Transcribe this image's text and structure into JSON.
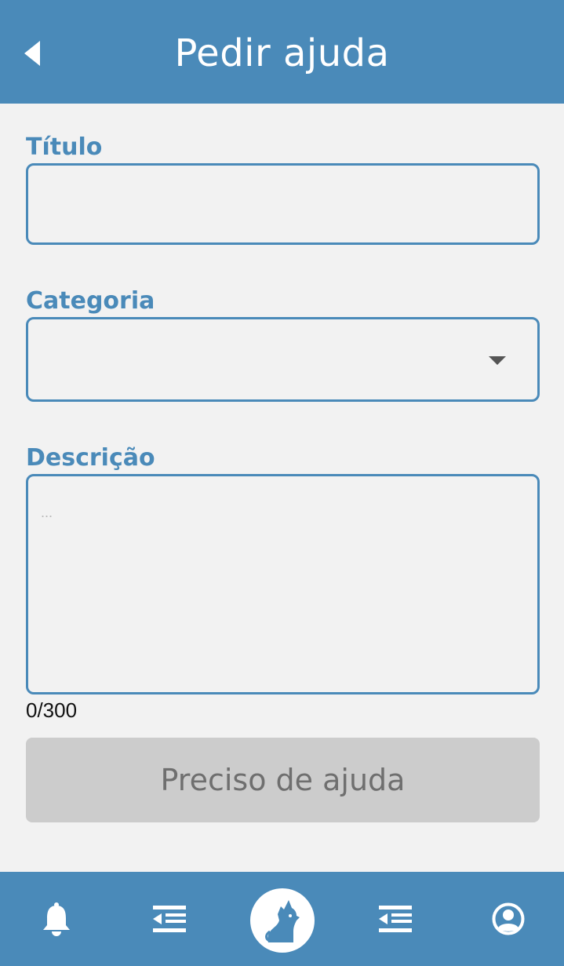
{
  "header": {
    "title": "Pedir ajuda",
    "back_icon": "chevron-left-icon"
  },
  "form": {
    "title_label": "Título",
    "title_value": "",
    "category_label": "Categoria",
    "category_value": "",
    "description_label": "Descrição",
    "description_value": "",
    "description_placeholder": "...",
    "counter": "0/300",
    "submit_label": "Preciso de ajuda"
  },
  "bottom_nav": {
    "items": [
      {
        "icon": "bell-icon"
      },
      {
        "icon": "list-indent-icon"
      },
      {
        "icon": "cat-logo-icon"
      },
      {
        "icon": "list-indent-icon"
      },
      {
        "icon": "user-avatar-icon"
      }
    ]
  },
  "colors": {
    "primary": "#4a8ab9",
    "background": "#f2f2f2",
    "button_disabled": "#cccccc",
    "button_text_disabled": "#6f6f6f"
  }
}
